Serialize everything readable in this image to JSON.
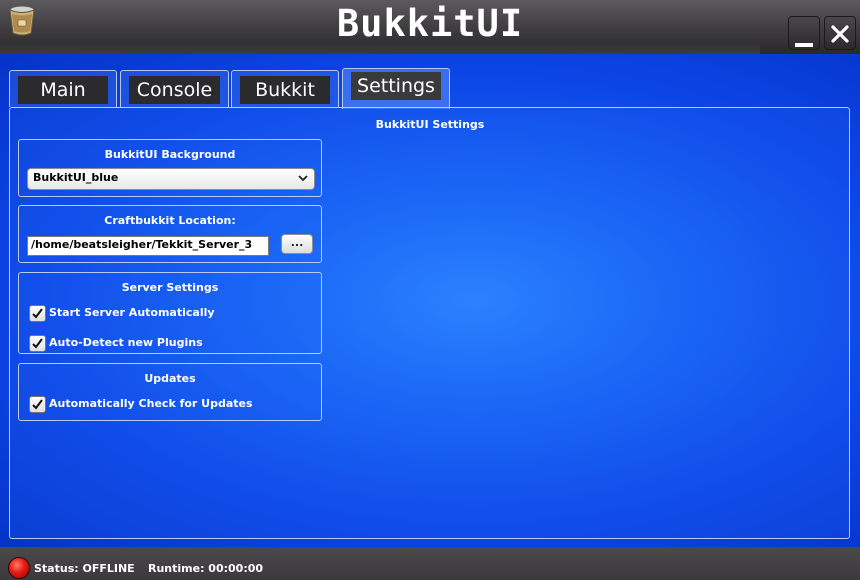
{
  "window": {
    "title": "BukkitUI",
    "logo_icon": "bukkit-bucket-icon",
    "minimize_icon": "minimize-icon",
    "close_icon": "close-icon"
  },
  "tabs": [
    {
      "label": "Main",
      "active": false
    },
    {
      "label": "Console",
      "active": false
    },
    {
      "label": "Bukkit",
      "active": false
    },
    {
      "label": "Settings",
      "active": true
    }
  ],
  "settings": {
    "title": "BukkitUI Settings",
    "background_group": {
      "title": "BukkitUI Background",
      "selected": "BukkitUI_blue",
      "dropdown_icon": "chevron-down-icon"
    },
    "location_group": {
      "title": "Craftbukkit Location:",
      "path": "/home/beatsleigher/Tekkit_Server_3",
      "browse_label": "..."
    },
    "server_group": {
      "title": "Server Settings",
      "options": [
        {
          "label": "Start Server Automatically",
          "checked": true
        },
        {
          "label": "Auto-Detect new Plugins",
          "checked": true
        }
      ]
    },
    "updates_group": {
      "title": "Updates",
      "options": [
        {
          "label": "Automatically Check for Updates",
          "checked": true
        }
      ]
    }
  },
  "status": {
    "indicator_color": "#e51a0e",
    "status_text": "Status: OFFLINE",
    "runtime_text": "Runtime: 00:00:00"
  },
  "colors": {
    "background": "#1866f5",
    "titlebar": "#3d3b3d"
  }
}
